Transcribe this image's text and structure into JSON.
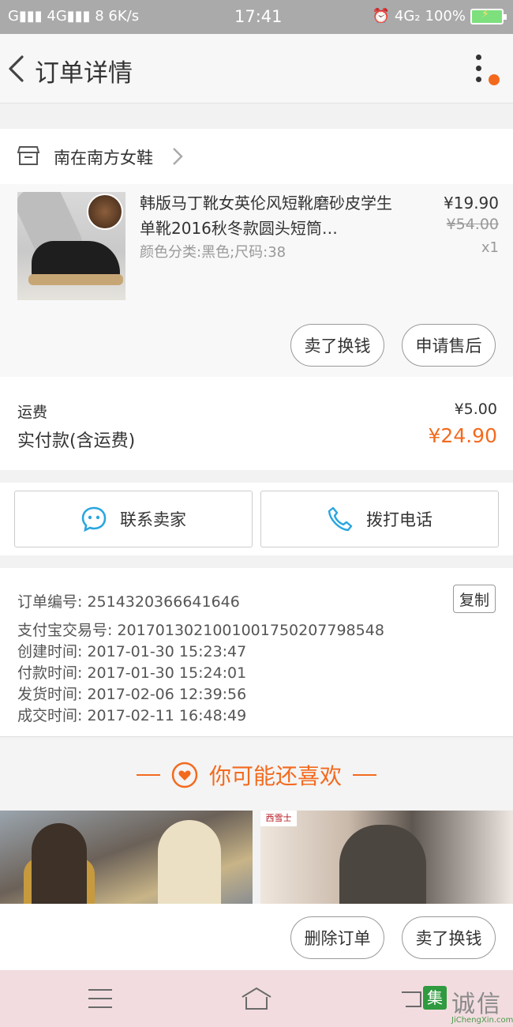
{
  "status_bar": {
    "left": "G▮▮▮ 4G▮▮▮ 8 6K/s",
    "time": "17:41",
    "network": "4G₂",
    "battery": "100%"
  },
  "header": {
    "title": "订单详情"
  },
  "shop": {
    "name": "南在南方女鞋"
  },
  "product": {
    "title": "韩版马丁靴女英伦风短靴磨砂皮学生单靴2016秋冬款圆头短筒…",
    "spec": "颜色分类:黑色;尺码:38",
    "price": "¥19.90",
    "original_price": "¥54.00",
    "quantity": "x1",
    "actions": [
      "卖了换钱",
      "申请售后"
    ]
  },
  "fees": {
    "shipping_label": "运费",
    "shipping_value": "¥5.00",
    "paid_label": "实付款(含运费)",
    "paid_value": "¥24.90"
  },
  "contact": {
    "seller_label": "联系卖家",
    "phone_label": "拨打电话"
  },
  "order_info": {
    "copy_label": "复制",
    "lines": [
      "订单编号: 2514320366641646",
      "支付宝交易号: 2017013021001001750207798548",
      "创建时间: 2017-01-30  15:23:47",
      "付款时间: 2017-01-30  15:24:01",
      "发货时间: 2017-02-06  12:39:56",
      "成交时间: 2017-02-11  16:48:49"
    ]
  },
  "recommend": {
    "title": "你可能还喜欢",
    "brand_tag": "西雪士"
  },
  "bottom_actions": [
    "删除订单",
    "卖了换钱"
  ],
  "watermark": {
    "text": "诚信",
    "box": "集",
    "sub": "JiChengXin.com"
  },
  "colors": {
    "accent": "#f36a1e",
    "status_bar": "#aaaaaa",
    "nav_bar": "#f2dcdf"
  }
}
